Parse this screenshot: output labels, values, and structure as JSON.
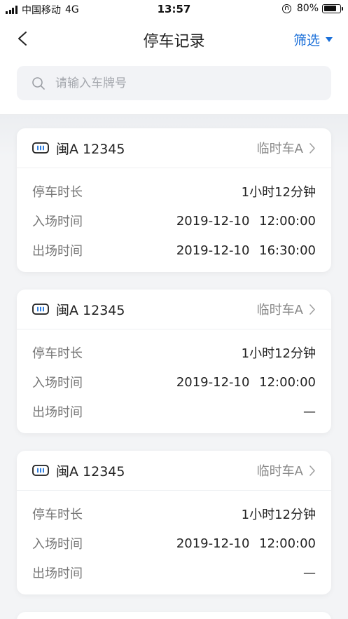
{
  "status_bar": {
    "carrier": "中国移动",
    "network": "4G",
    "time": "13:57",
    "battery": "80%"
  },
  "nav": {
    "title": "停车记录",
    "filter_label": "筛选"
  },
  "search": {
    "placeholder": "请输入车牌号"
  },
  "labels": {
    "duration": "停车时长",
    "entry": "入场时间",
    "exit": "出场时间"
  },
  "records": [
    {
      "plate": "闽A 12345",
      "type": "临时车A",
      "duration": "1小时12分钟",
      "entry": "2019-12-10 12:00:00",
      "exit": "2019-12-10 16:30:00"
    },
    {
      "plate": "闽A 12345",
      "type": "临时车A",
      "duration": "1小时12分钟",
      "entry": "2019-12-10 12:00:00",
      "exit": "—"
    },
    {
      "plate": "闽A 12345",
      "type": "临时车A",
      "duration": "1小时12分钟",
      "entry": "2019-12-10 12:00:00",
      "exit": "—"
    }
  ],
  "colors": {
    "accent": "#1a6fd9",
    "background": "#f3f4f6"
  }
}
